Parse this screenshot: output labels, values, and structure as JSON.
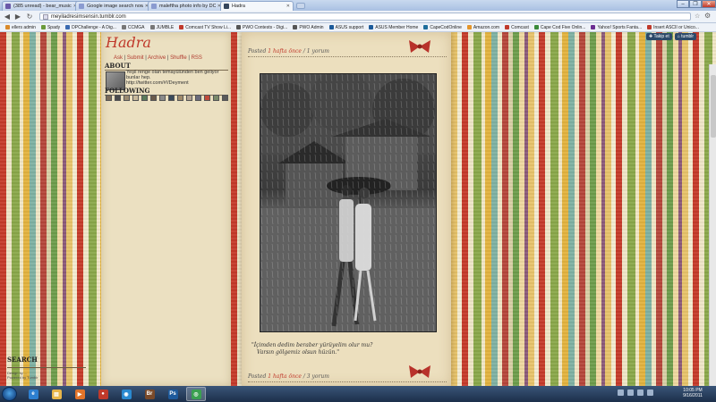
{
  "browser": {
    "tabs": [
      {
        "label": "(385 unread) - bear_music",
        "fav_color": "#6a5aa8"
      },
      {
        "label": "Google image search now",
        "fav_color": "#8a9bd0"
      },
      {
        "label": "maleftha photo info by DC",
        "fav_color": "#8a9bd0"
      },
      {
        "label": "Hadra",
        "fav_color": "#35465c"
      }
    ],
    "new_tab_icon": "new-tab-icon",
    "window_controls": [
      "–",
      "❐",
      "✕"
    ],
    "nav": {
      "back": "◀",
      "forward": "▶",
      "reload": "↻"
    },
    "url": "meyiladresimsensin.tumblr.com",
    "bookmarks": [
      {
        "label": "ellers admin",
        "color": "#d98a2b"
      },
      {
        "label": "Spady",
        "color": "#6a9a3a"
      },
      {
        "label": "DPChallenge - A Dig...",
        "color": "#3a6ab0"
      },
      {
        "label": "CCMGA",
        "color": "#777777"
      },
      {
        "label": "JUMBLE",
        "color": "#777777"
      },
      {
        "label": "Comcast TV Show Li...",
        "color": "#c0392b"
      },
      {
        "label": "PWO Contests - Digi...",
        "color": "#555555"
      },
      {
        "label": "PWO Admin",
        "color": "#555555"
      },
      {
        "label": "ASUS support",
        "color": "#1b5a9a"
      },
      {
        "label": "ASUS Member Home",
        "color": "#1b5a9a"
      },
      {
        "label": "CapeCodOnline",
        "color": "#1f6e9c"
      },
      {
        "label": "Amazon.com",
        "color": "#e4952a"
      },
      {
        "label": "Comcast",
        "color": "#c0392b"
      },
      {
        "label": "Cape Cod Five Onlin...",
        "color": "#3a8a3a"
      },
      {
        "label": "Yahoo! Sports Fanta...",
        "color": "#6b2c91"
      },
      {
        "label": "Insert ASCII or Unico...",
        "color": "#c0392b"
      }
    ]
  },
  "tumblr_bar": {
    "follow": "Takip et",
    "dashboard": "tumblr"
  },
  "blog": {
    "title": "Hadra",
    "nav_links": [
      "Ask",
      "Submit",
      "Archive",
      "Shuffle",
      "RSS"
    ],
    "about_heading": "ABOUT",
    "about_text": "Yeşil renge olan temayülünden ben geliyor bunlar hep.",
    "about_link": "http://twitter.com/#!/Deyment",
    "following_heading": "FOLLOWING",
    "following_colors": [
      "#7a6a58",
      "#4a4a4a",
      "#9a8a70",
      "#c8b89a",
      "#5a7a5a",
      "#6a5a4a",
      "#8a8a8a",
      "#3a4a5a",
      "#a08a6a",
      "#b0a090",
      "#6a6a7a",
      "#c04a3a",
      "#7a8a6a",
      "#5a5a5a"
    ],
    "search_heading": "SEARCH",
    "credit": [
      "Design by ...",
      "Powered by Tumblr"
    ]
  },
  "post": {
    "meta_prefix": "Posted",
    "time": "1 hafta önce",
    "sep": "/",
    "comments": "1 yorum",
    "caption_line1": "\"İçimden dedim beraber yürüyelim olur mu?",
    "caption_line2": "Varsın gölgemiz olsun hüzün.\""
  },
  "post2": {
    "meta_prefix": "Posted",
    "time": "1 hafta önce",
    "sep": "/",
    "comments": "3 yorum"
  },
  "taskbar": {
    "apps": [
      {
        "name": "internet-explorer",
        "glyph": "e",
        "color": "#2d7fd0"
      },
      {
        "name": "windows-explorer",
        "glyph": "▤",
        "color": "#e8b64a"
      },
      {
        "name": "media-player",
        "glyph": "▶",
        "color": "#e2742a"
      },
      {
        "name": "red-app",
        "glyph": "●",
        "color": "#c0392b"
      },
      {
        "name": "blue-app",
        "glyph": "◉",
        "color": "#2a8ad0"
      },
      {
        "name": "bridge-app",
        "glyph": "Br",
        "color": "#7a4a2a"
      },
      {
        "name": "photoshop",
        "glyph": "Ps",
        "color": "#1d5a9c"
      },
      {
        "name": "chrome",
        "glyph": "◎",
        "color": "#3aa050"
      }
    ],
    "time": "10:05 PM",
    "date": "9/16/2011"
  }
}
